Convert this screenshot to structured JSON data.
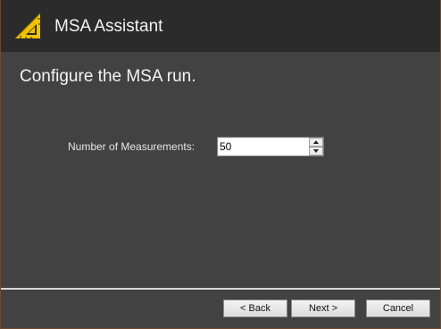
{
  "window": {
    "title": "MSA Assistant",
    "logo_icon": "triangle-ruler-icon"
  },
  "main": {
    "heading": "Configure the MSA run.",
    "measurements": {
      "label": "Number of Measurements:",
      "value": "50"
    }
  },
  "footer": {
    "back_label": "< Back",
    "next_label": "Next >",
    "cancel_label": "Cancel"
  },
  "colors": {
    "background": "#424242",
    "titlebar": "#2b2b2b",
    "logo_accent": "#f2c200"
  }
}
